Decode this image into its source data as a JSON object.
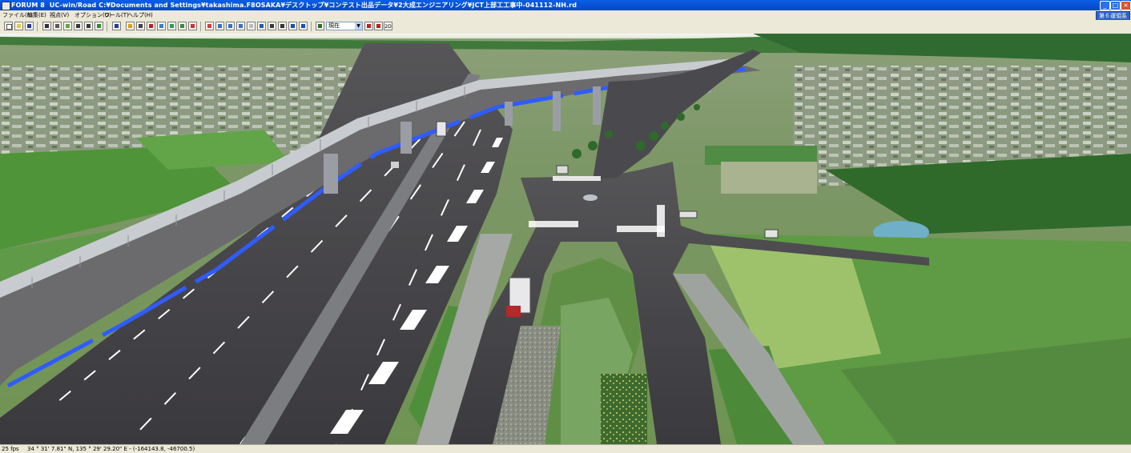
{
  "window": {
    "app_name": "FORUM 8",
    "title": "UC-win/Road    C:¥Documents and Settings¥takashima.F8OSAKA¥デスクトップ¥コンテスト出品データ¥2大成エンジニアリング¥JCT上部工工事中-041112-NH.rd",
    "controls": [
      "_",
      "□",
      "×"
    ]
  },
  "menu": {
    "items": [
      "ファイル(F)",
      "編集(E)",
      "視点(V)",
      "オプション(O)",
      "ツール(T)",
      "ヘルプ(H)"
    ],
    "status_tab": "第６運領系"
  },
  "toolbar": {
    "view_mode": "現在",
    "dropdown_arrow": "▼",
    "btn_2d": "2D"
  },
  "statusbar": {
    "fps": "25 fps",
    "coordinates": "34 °   31' 7.81\" N, 135 °   29' 29.20\" E  -  (-164143.8, -46700.5)"
  },
  "colors": {
    "titlebar": "#0846c6",
    "road_asphalt": "#3e3e42",
    "blue_marking": "#2f5cff",
    "grass": "#6aa34b"
  }
}
